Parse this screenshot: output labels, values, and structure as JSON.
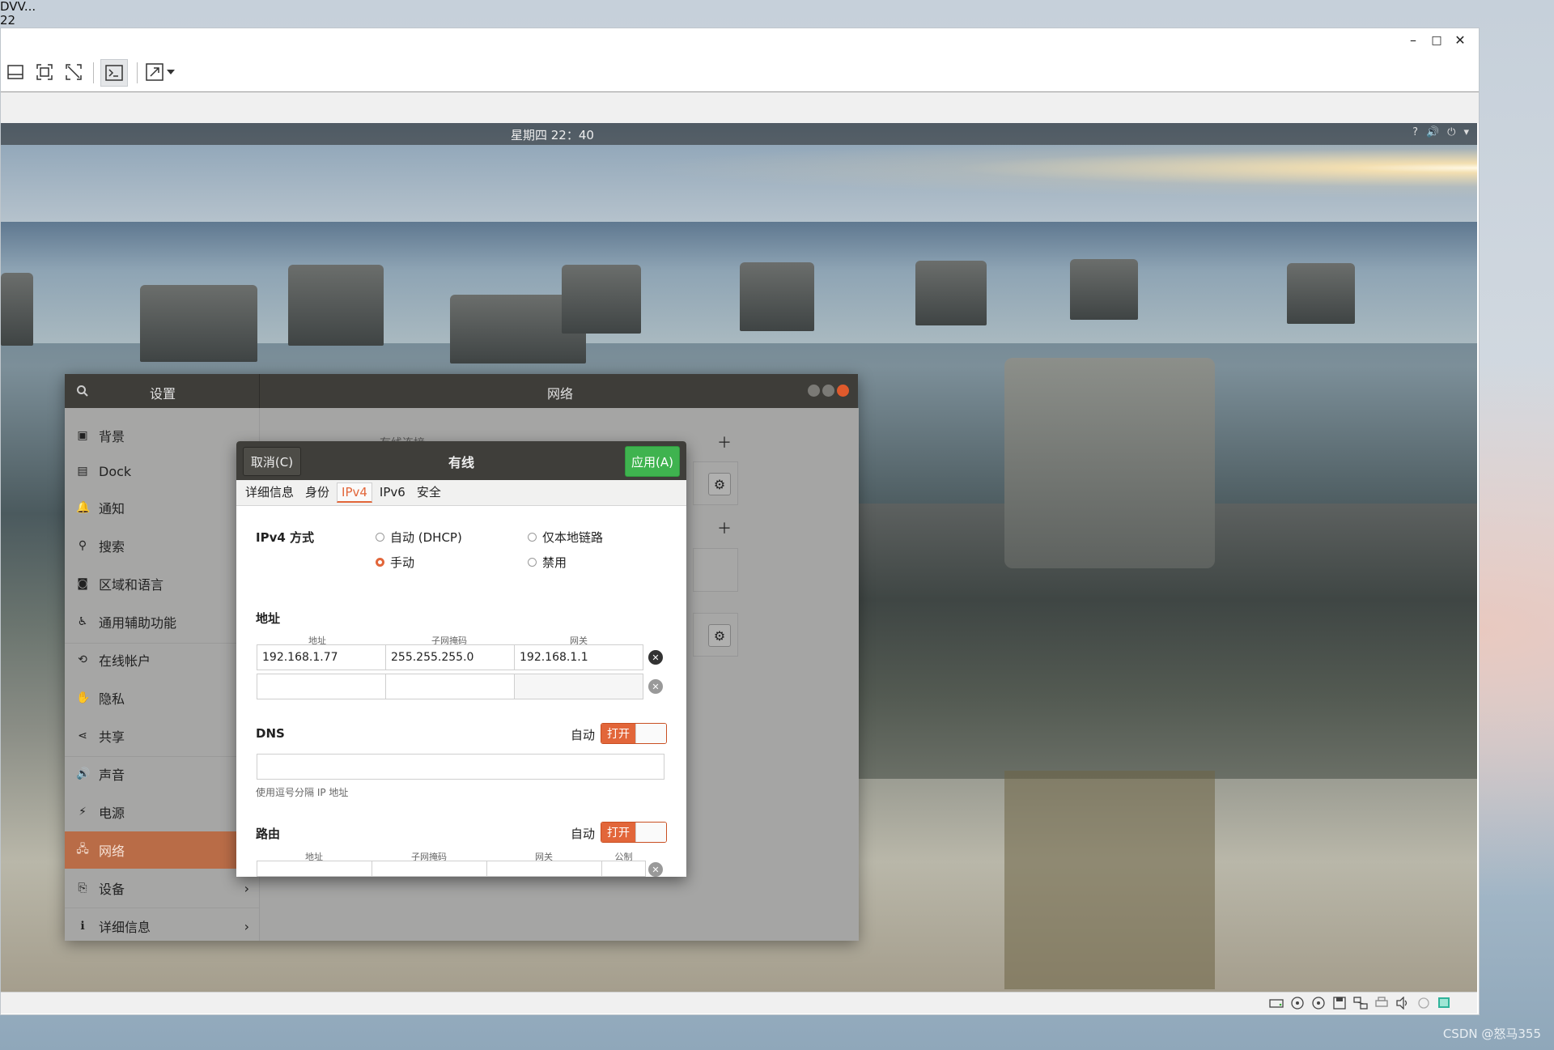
{
  "host": {
    "corner_lines": [
      "DVV...",
      "22"
    ],
    "watermark": "CSDN @怒马355"
  },
  "vm": {
    "window_controls": {
      "minimize": "–",
      "maximize": "□",
      "close": "✕"
    },
    "toolbar_icons": [
      "layout-icon",
      "fit-window-icon",
      "unscale-icon",
      "console-icon",
      "fullscreen-icon",
      "dropdown-icon"
    ],
    "status_icons": [
      "hdd-icon",
      "optical-icon",
      "optical2-icon",
      "floppy-icon",
      "network-icon",
      "printer-icon",
      "audio-icon",
      "disc-icon",
      "vm-icon"
    ]
  },
  "guest": {
    "clock": "星期四 22：40",
    "tray": {
      "help": "?",
      "volume": "🔊",
      "power": "⏻",
      "menu": "▾"
    }
  },
  "settings": {
    "title": "设置",
    "panel_title": "网络",
    "sidebar": [
      {
        "label": "背景",
        "icon": "background-icon"
      },
      {
        "label": "Dock",
        "icon": "dock-icon"
      },
      {
        "label": "通知",
        "icon": "bell-icon"
      },
      {
        "label": "搜索",
        "icon": "search-icon"
      },
      {
        "label": "区域和语言",
        "icon": "region-icon"
      },
      {
        "label": "通用辅助功能",
        "icon": "accessibility-icon"
      },
      {
        "label": "在线帐户",
        "icon": "online-accounts-icon"
      },
      {
        "label": "隐私",
        "icon": "privacy-hand-icon"
      },
      {
        "label": "共享",
        "icon": "share-icon"
      },
      {
        "label": "声音",
        "icon": "sound-icon"
      },
      {
        "label": "电源",
        "icon": "power-icon"
      },
      {
        "label": "网络",
        "icon": "network-icon",
        "selected": true
      },
      {
        "label": "设备",
        "icon": "devices-icon",
        "arrow": true
      },
      {
        "label": "详细信息",
        "icon": "info-icon",
        "arrow": true
      }
    ],
    "partial_heading": "有线连接"
  },
  "dialog": {
    "title": "有线",
    "cancel_label": "取消(C)",
    "apply_label": "应用(A)",
    "tabs": [
      "详细信息",
      "身份",
      "IPv4",
      "IPv6",
      "安全"
    ],
    "active_tab": "IPv4",
    "ipv4_method": {
      "label": "IPv4 方式",
      "options": [
        "自动 (DHCP)",
        "仅本地链路",
        "手动",
        "禁用"
      ],
      "selected": "手动"
    },
    "address": {
      "heading": "地址",
      "columns": [
        "地址",
        "子网掩码",
        "网关"
      ],
      "rows": [
        {
          "address": "192.168.1.77",
          "netmask": "255.255.255.0",
          "gateway": "192.168.1.1"
        },
        {
          "address": "",
          "netmask": "",
          "gateway": ""
        }
      ]
    },
    "dns": {
      "heading": "DNS",
      "auto_label": "自动",
      "toggle_label": "打开",
      "value": "",
      "hint": "使用逗号分隔 IP 地址"
    },
    "routes": {
      "heading": "路由",
      "auto_label": "自动",
      "toggle_label": "打开",
      "columns": [
        "地址",
        "子网掩码",
        "网关",
        "公制"
      ]
    }
  }
}
